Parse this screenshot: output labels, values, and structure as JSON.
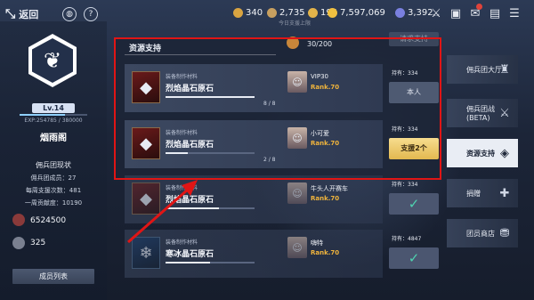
{
  "topbar": {
    "back_label": "返回",
    "help_icon": "help-icon",
    "resources": [
      {
        "icon": "gold-pile-icon",
        "value": "340",
        "color": "#d9a441"
      },
      {
        "icon": "ore-icon",
        "value": "2,735",
        "color": "#c8a060"
      },
      {
        "icon": "medal-icon",
        "value": "194",
        "color": "#e2b34a"
      },
      {
        "icon": "coin-icon",
        "value": "7,597,069",
        "color": "#f0c040"
      },
      {
        "icon": "crystal-icon",
        "value": "3,392",
        "color": "#7a80e0"
      }
    ]
  },
  "guild": {
    "level": "Lv.14",
    "exp_text": "EXP:254785 / 380000",
    "exp_fraction": 0.67,
    "name": "烟雨阁",
    "stats_title": "佣兵团现状",
    "members": "佣兵团成员：27",
    "weekly_support": "每周支援次数：481",
    "weekly_contribution": "一周贡献度：10190",
    "currency1": "6524500",
    "currency2": "325",
    "member_list_button": "成员列表"
  },
  "panel": {
    "title": "资源支持",
    "capacity": "30/200",
    "request_button": "请求支持",
    "faded_header": "今日支援上限"
  },
  "rows": [
    {
      "category": "装备制作材料",
      "item": "烈焰晶石原石",
      "count": "8 / 8",
      "fraction": 1.0,
      "user": "VIP30",
      "rank": "Rank.70",
      "hold": "持有：334",
      "action": "本人",
      "kind": "self",
      "dim": false,
      "blue": false
    },
    {
      "category": "装备制作材料",
      "item": "烈焰晶石原石",
      "count": "2 / 8",
      "fraction": 0.25,
      "user": "小可爱",
      "rank": "Rank.70",
      "hold": "持有：334",
      "action": "支援2个",
      "kind": "support",
      "dim": false,
      "blue": false
    },
    {
      "category": "装备制作材料",
      "item": "烈焰晶石原石",
      "count": "",
      "fraction": 0.6,
      "user": "牛头人开赛车",
      "rank": "Rank.70",
      "hold": "持有：334",
      "action": "✓",
      "kind": "check",
      "dim": true,
      "blue": false
    },
    {
      "category": "装备制作材料",
      "item": "寒冰晶石原石",
      "count": "",
      "fraction": 0.5,
      "user": "嗨特",
      "rank": "Rank.70",
      "hold": "持有：4847",
      "action": "✓",
      "kind": "check",
      "dim": true,
      "blue": true
    }
  ],
  "tabs": [
    {
      "label": "佣兵团大厅",
      "icon": "castle-icon",
      "active": false
    },
    {
      "label": "佣兵团战(BETA)",
      "icon": "crossed-swords-icon",
      "active": false
    },
    {
      "label": "资源支持",
      "icon": "treasure-icon",
      "active": true
    },
    {
      "label": "捐赠",
      "icon": "donate-icon",
      "active": false
    },
    {
      "label": "团员商店",
      "icon": "shop-icon",
      "active": false
    }
  ]
}
